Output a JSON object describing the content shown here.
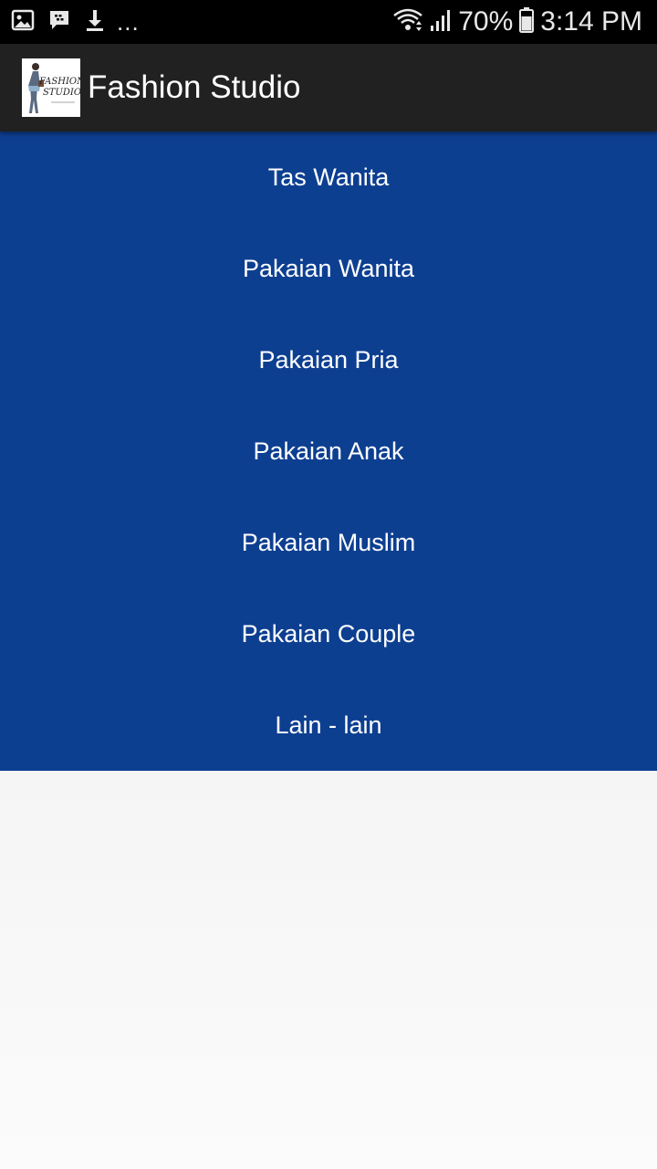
{
  "status_bar": {
    "icons": [
      "gallery-icon",
      "bbm-icon",
      "download-icon"
    ],
    "overflow": "...",
    "battery_percent": "70%",
    "time": "3:14 PM"
  },
  "app_bar": {
    "title": "Fashion Studio",
    "logo_text": [
      "FASHION",
      "STUDIO"
    ]
  },
  "menu": {
    "background_color": "#0d3f91",
    "items": [
      {
        "label": "Tas Wanita"
      },
      {
        "label": "Pakaian Wanita"
      },
      {
        "label": "Pakaian Pria"
      },
      {
        "label": "Pakaian Anak"
      },
      {
        "label": "Pakaian Muslim"
      },
      {
        "label": "Pakaian Couple"
      },
      {
        "label": "Lain - lain"
      }
    ]
  }
}
